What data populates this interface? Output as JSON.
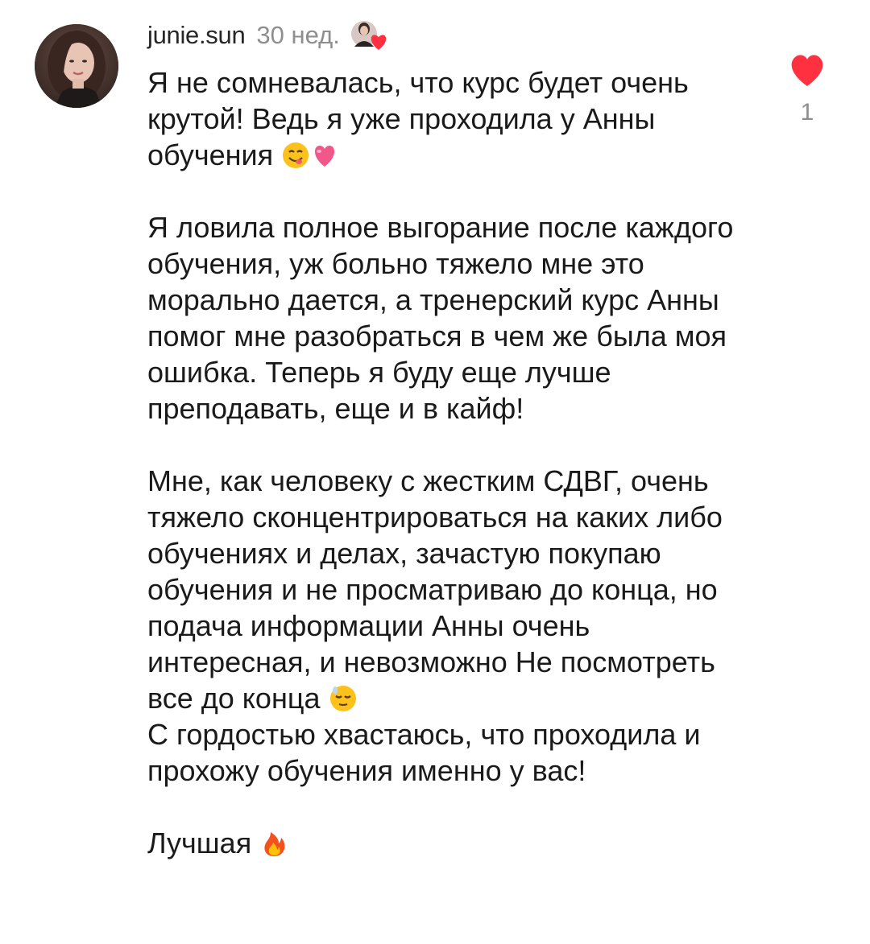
{
  "comment": {
    "username": "junie.sun",
    "time": "30 нед.",
    "paragraphs": [
      "Я не сомневалась, что курс будет очень крутой! Ведь я уже проходила у Анны обучения",
      "Я ловила полное выгорание после каждого обучения, уж больно тяжело мне это морально дается, а тренерский курс Анны помог мне разобраться в чем же была моя ошибка. Теперь я буду еще лучше преподавать, еще и в кайф!",
      "Мне, как человеку с жестким СДВГ, очень тяжело сконцентрироваться на каких либо обучениях и делах, зачастую покупаю обучения и не просматриваю до конца, но подача информации Анны очень интересная, и невозможно Не посмотреть все до конца",
      "С гордостью хвастаюсь, что проходила и прохожу обучения именно у вас!",
      "Лучшая"
    ],
    "emojis": {
      "p1": [
        "savoring-face-emoji",
        "pink-heart-emoji"
      ],
      "p3": "relieved-face-emoji",
      "p5": "fire-emoji"
    }
  },
  "like": {
    "count": "1",
    "color": "#ff3040",
    "icon": "heart-icon",
    "liked": true
  },
  "author_like_badge": {
    "icon": "author-liked-heart-icon",
    "heart_color": "#ff3040"
  }
}
